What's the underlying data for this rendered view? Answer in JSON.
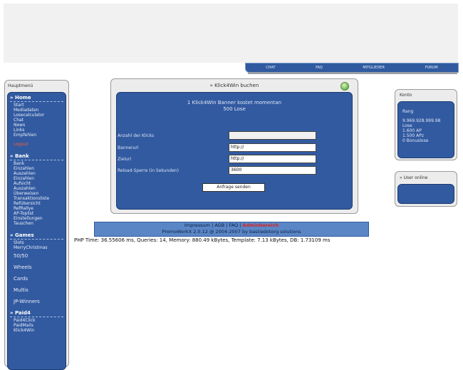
{
  "topnav": [
    "CHAT",
    "FAQ",
    "MITGLIEDER",
    "FORUM"
  ],
  "left_panel": {
    "title": "Hauptmenü",
    "sections": [
      {
        "head": "Home",
        "links": [
          "Start",
          "Mediadaten",
          "Losecalculator",
          "Chat",
          "News",
          "Links",
          "Empfehlen"
        ],
        "extra": "Logout"
      },
      {
        "head": "Bank",
        "links": [
          "Bank",
          "Einzahlen",
          "Auszahlen",
          "Einzahlen",
          "Aufsicht",
          "Auszahlen",
          "Überweisen",
          "Transaktionsliste",
          "Refübersicht",
          "RefRallye",
          "AP-Toplist",
          "Einstellungen",
          "Tauschen"
        ]
      },
      {
        "head": "Games",
        "links": [
          "Slots",
          "MerryChristmas"
        ],
        "big_links": [
          "50/50",
          "Wheels",
          "Cards",
          "Multis",
          "JP-Winners"
        ]
      },
      {
        "head": "Paid4",
        "links": [
          "Paid4Click",
          "PaidMails",
          "Klick4Win"
        ]
      }
    ]
  },
  "center_panel": {
    "title": "» Klick4Win buchen",
    "info_line1": "1 Klick4Win Banner kostet momentan",
    "info_line2": "500 Lose",
    "fields": [
      {
        "label": "Anzahl der Klicks",
        "value": ""
      },
      {
        "label": "Bannerurl",
        "value": "http://"
      },
      {
        "label": "Zielurl",
        "value": "http://"
      },
      {
        "label": "Reload-Sperre (in Sekunden)",
        "value": "3600"
      }
    ],
    "submit_label": "Anfrage senden"
  },
  "right_panel_1": {
    "title": "Konto",
    "lines": [
      "Rang",
      "9.969.928.999.98",
      "Lose",
      "1.600 AP",
      "1.500 APz",
      "0 Bonuslose"
    ]
  },
  "right_panel_2": {
    "title": "» User online"
  },
  "footer": {
    "links": [
      "Impressum",
      "AGB",
      "FAQ"
    ],
    "admin_label": "Adminbereich",
    "credit": "PromoWorkX 2.0.12 @ 2004-2007 by bastiedotorg solutions",
    "php_line": "PHP Time: 36.55606 ms, Queries: 14, Memory: 880.49 kBytes, Template: 7.13 kBytes, DB: 1.73109 ms"
  },
  "colors": {
    "accent": "#325aa0",
    "admin": "#e02020",
    "logout": "#ff5b3a"
  }
}
